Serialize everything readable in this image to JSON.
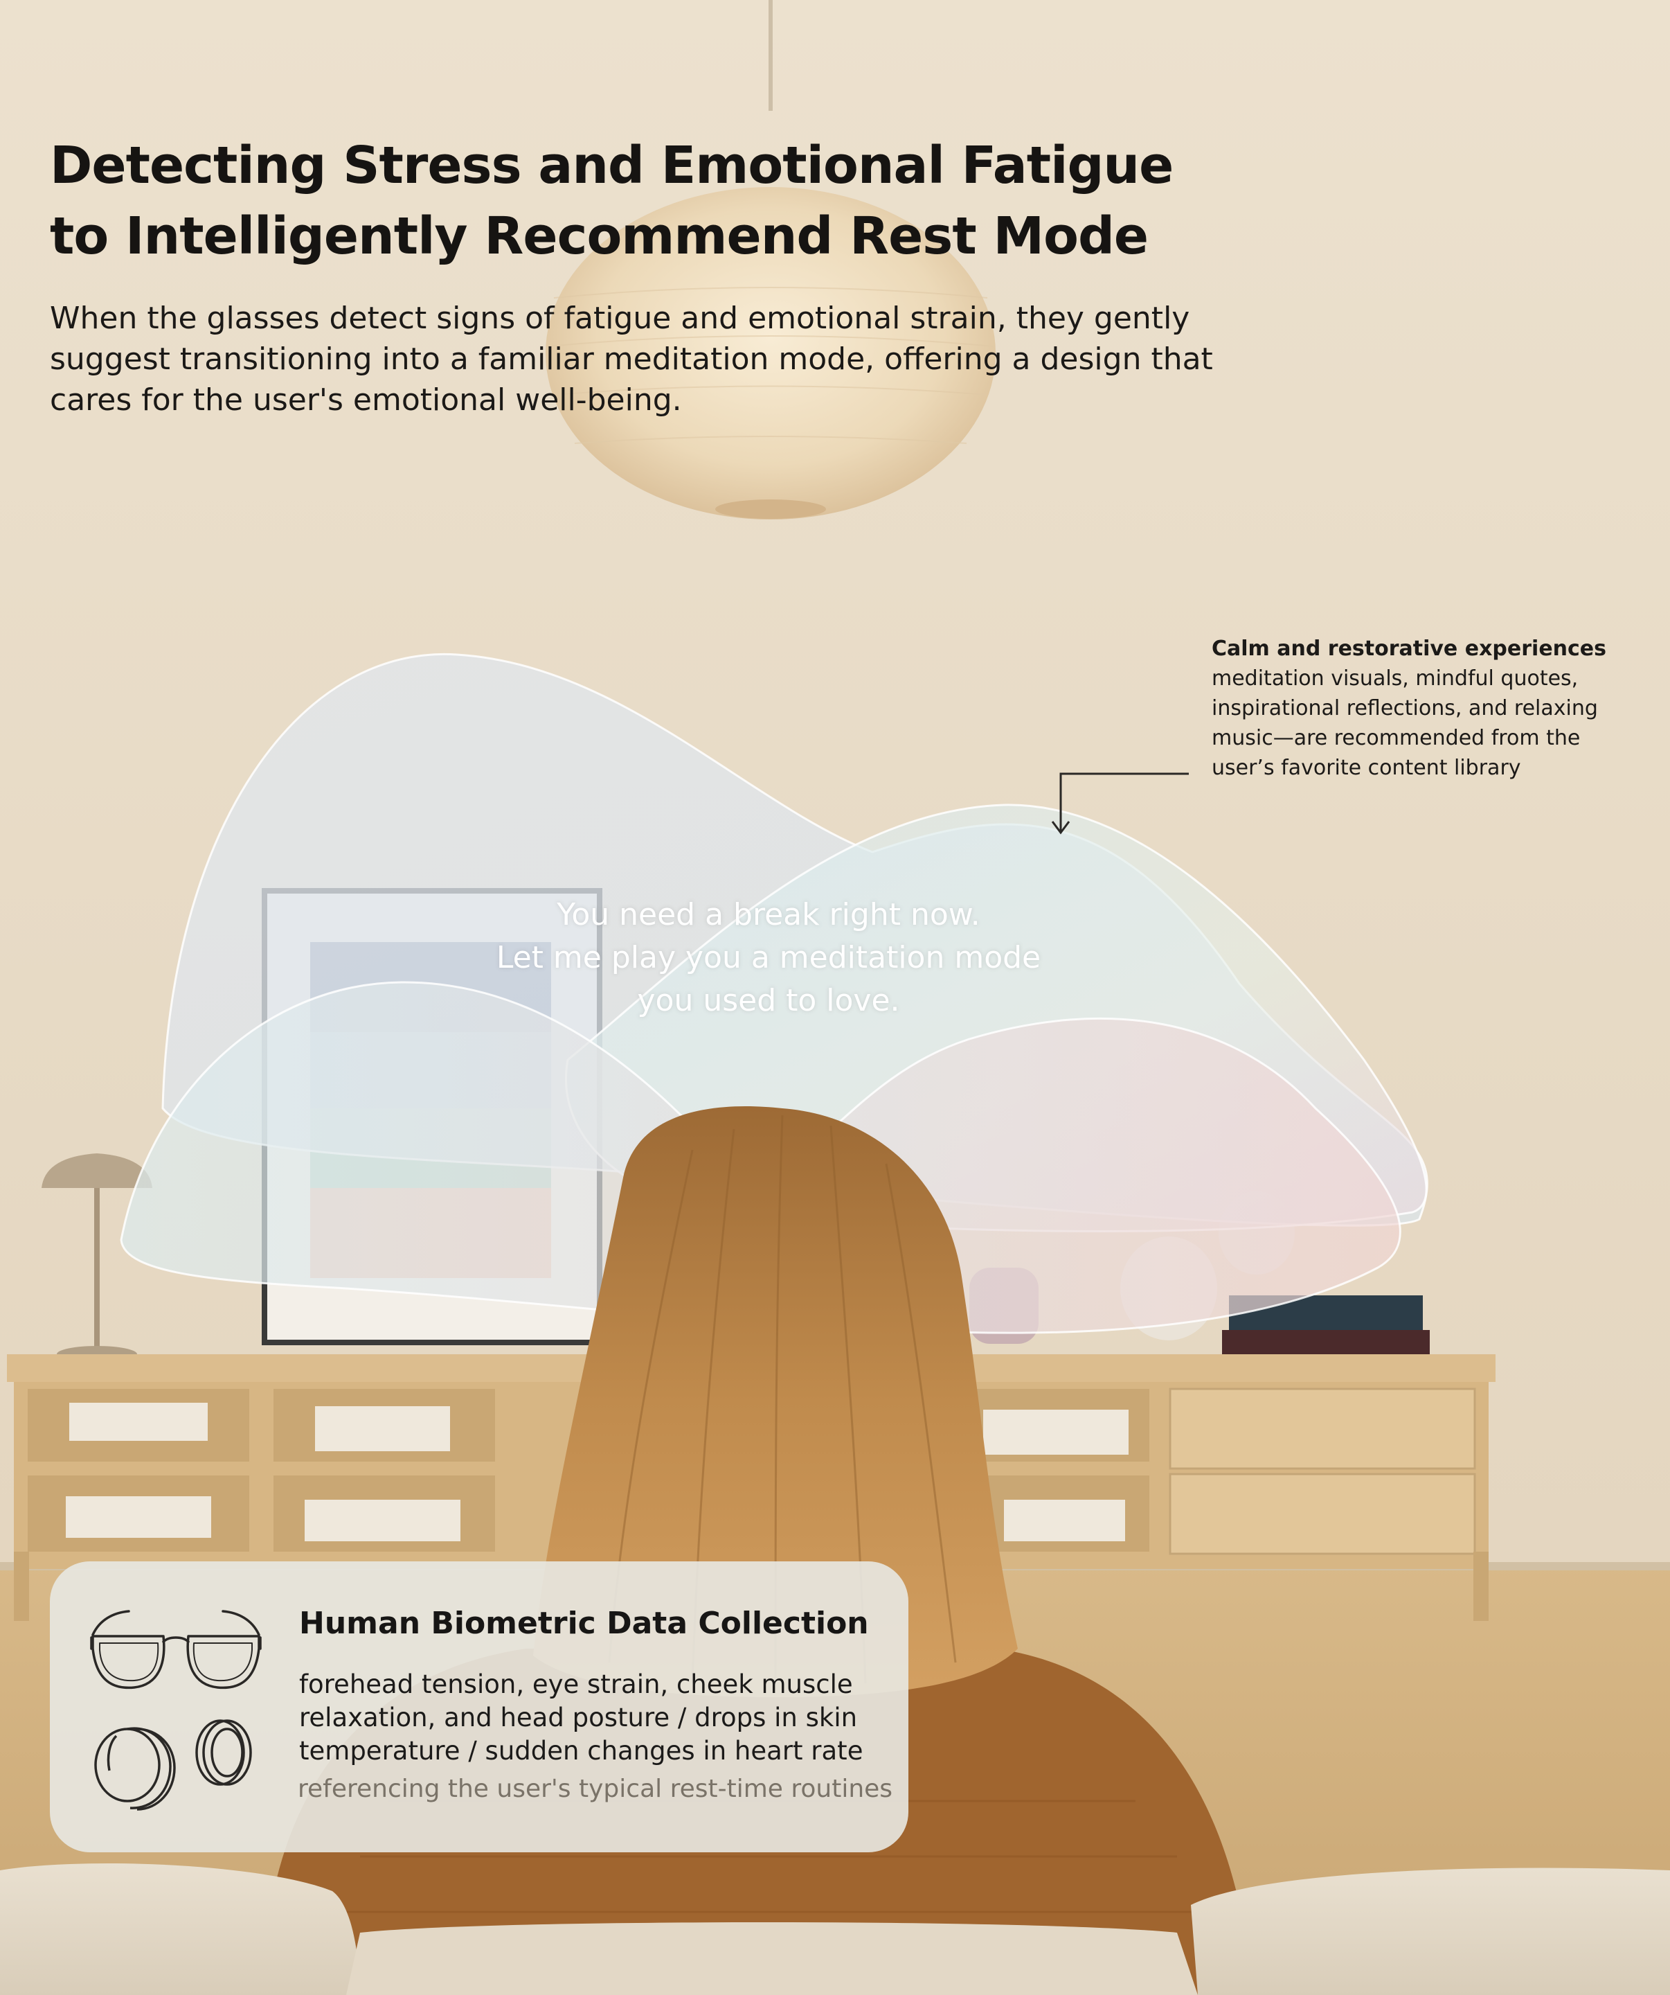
{
  "header": {
    "title_lines": [
      "Detecting Stress and Emotional Fatigue",
      "to Intelligently Recommend Rest Mode"
    ],
    "description_lines": [
      "When the glasses detect signs of fatigue and emotional strain, they gently",
      "suggest transitioning into a familiar meditation mode, offering a design that",
      "cares for the user's emotional well-being."
    ]
  },
  "callout": {
    "title": "Calm and restorative experiences",
    "lines": [
      "meditation visuals, mindful quotes,",
      "inspirational reflections, and relaxing",
      "music—are recommended from the",
      "user’s favorite content library"
    ]
  },
  "ar_message": {
    "lines": [
      "You need a break right now.",
      "Let me play you a meditation mode",
      "you used to love."
    ]
  },
  "biometric_card": {
    "title": "Human Biometric Data Collection",
    "body_lines": [
      "forehead tension, eye strain, cheek muscle",
      "relaxation, and head posture / drops in skin",
      "temperature / sudden changes in heart rate"
    ],
    "note": "referencing the user's typical rest-time routines",
    "icons": [
      "smart-glasses-icon",
      "smartwatch-icon",
      "smart-ring-icon"
    ]
  },
  "colors": {
    "wall": "#e9dcc8",
    "text_dark": "#161412",
    "card_bg": "#e8e8e2",
    "note_text": "#7a7368",
    "hair": "#b07a3e",
    "sweater": "#a0652f"
  }
}
